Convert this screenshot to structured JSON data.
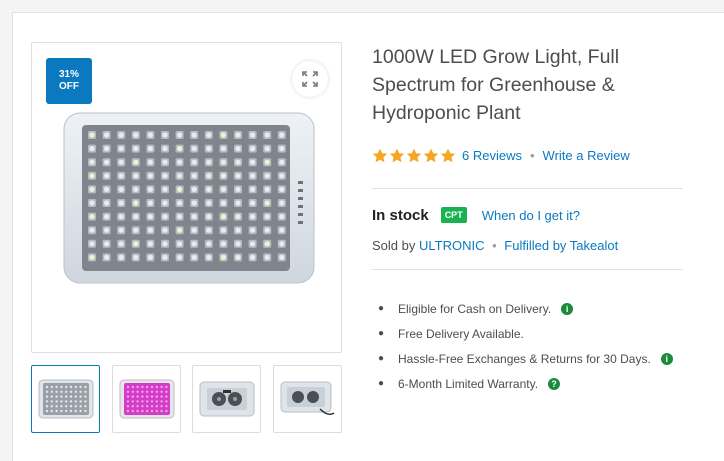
{
  "product": {
    "title": "1000W LED Grow Light, Full Spectrum for Greenhouse & Hydroponic Plant",
    "discount_badge": {
      "percent": "31%",
      "label": "OFF"
    },
    "rating_stars": 5,
    "reviews_link": "6 Reviews",
    "write_review_link": "Write a Review"
  },
  "stock": {
    "status": "In stock",
    "location_badge": "CPT",
    "delivery_link": "When do I get it?"
  },
  "seller": {
    "sold_by_label": "Sold by",
    "seller_name": "ULTRONIC",
    "fulfilled_by": "Fulfilled by Takealot"
  },
  "benefits": [
    {
      "text": "Eligible for Cash on Delivery.",
      "icon": "info-icon"
    },
    {
      "text": "Free Delivery Available.",
      "icon": null
    },
    {
      "text": "Hassle-Free Exchanges & Returns for 30 Days.",
      "icon": "info-icon"
    },
    {
      "text": "6-Month Limited Warranty.",
      "icon": "help-icon"
    }
  ],
  "gallery": {
    "thumbnails": [
      "white-led-panel",
      "pink-led-panel",
      "led-panel-back",
      "led-panel-back-cable"
    ],
    "active_thumbnail": 0
  },
  "colors": {
    "brand_blue": "#0b79bf",
    "stock_green": "#17b353",
    "star_yellow": "#f5a623",
    "info_green": "#1a8a3e"
  }
}
